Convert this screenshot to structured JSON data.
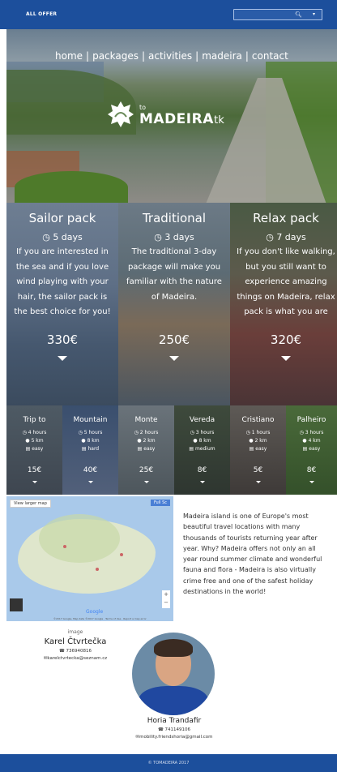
{
  "topbar": {
    "offer_label": "ALL OFFER",
    "search_icon": "search-icon",
    "caret_icon": "caret-icon"
  },
  "hero": {
    "nav": [
      "home",
      "packages",
      "activities",
      "madeira",
      "contact"
    ],
    "separator": "|",
    "logo": {
      "prefix": "to",
      "name": "MADEIRA",
      "suffix": ".tk"
    }
  },
  "packages": [
    {
      "title": "Sailor pack",
      "duration": "5 days",
      "description": "If you are interested in the sea and if you love wind playing with your hair, the sailor pack is the best choice for you!",
      "price": "330€"
    },
    {
      "title": "Traditional",
      "duration": "3 days",
      "description": "The traditional 3-day package will make you familiar with the nature of Madeira.",
      "price": "250€"
    },
    {
      "title": "Relax pack",
      "duration": "7 days",
      "description": "If you don't like walking, but you still want to experience amazing things on Madeira, relax pack is what you are",
      "price": "320€"
    }
  ],
  "activities": [
    {
      "name": "Trip to",
      "hours": "4 hours",
      "distance": "5 km",
      "difficulty": "easy",
      "price": "15€"
    },
    {
      "name": "Mountain",
      "hours": "5 hours",
      "distance": "8 km",
      "difficulty": "hard",
      "price": "40€"
    },
    {
      "name": "Monte",
      "hours": "2 hours",
      "distance": "2 km",
      "difficulty": "easy",
      "price": "25€"
    },
    {
      "name": "Vereda",
      "hours": "3 hours",
      "distance": "8 km",
      "difficulty": "medium",
      "price": "8€"
    },
    {
      "name": "Cristiano",
      "hours": "1 hours",
      "distance": "2 km",
      "difficulty": "easy",
      "price": "5€"
    },
    {
      "name": "Palheiro",
      "hours": "3 hours",
      "distance": "4 km",
      "difficulty": "easy",
      "price": "8€"
    }
  ],
  "map": {
    "view_larger": "View larger map",
    "fullscreen": "Full Sc",
    "google": "Google",
    "credits": "©2017 Google, Map data ©2017 Google · Terms of Use · Report a map error",
    "zoom_in": "+",
    "zoom_out": "−"
  },
  "island_text": "Madeira island is one of Europe's most beautiful travel locations with many thousands of tourists returning year after year. Why? Madeira offers not only an all year round summer climate and wonderful fauna and flora - Madeira is also virtually crime free and one of the safest holiday destinations in the world!",
  "contacts": [
    {
      "label": "image",
      "name": "Karel Čtvrtečka",
      "phone": "736940816",
      "email": "karelctvrtecka@seznam.cz"
    },
    {
      "name": "Horia Trandafir",
      "phone": "741149106",
      "email": "mobility.friendshoria@gmail.com"
    }
  ],
  "footer": {
    "copyright": "© TOMADEIRA 2017"
  },
  "colors": {
    "primary": "#1c4f9c",
    "text": "#333333"
  }
}
